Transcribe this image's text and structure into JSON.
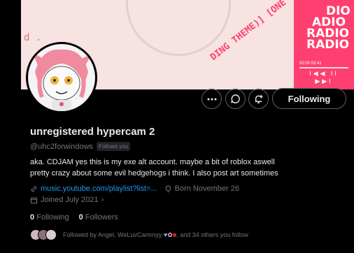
{
  "banner": {
    "left_text": "d .",
    "radio_lines": [
      "DIO",
      "ADIO",
      "RADIO",
      "RADIO"
    ],
    "diagonal_text": "DING THEME)] [ONE",
    "player_time": "02:00   03:41",
    "player_controls": "I◀◀ II ▶▶I"
  },
  "profile": {
    "display_name": "unregistered hypercam 2",
    "handle": "@uhc2forwindows",
    "follows_you_badge": "Follows you",
    "bio_line1": "aka. CDJAM yes this is my exe alt account. maybe a bit of roblox aswell",
    "bio_line2": "pretty crazy about some evil hedgehogs i think. I also post art sometimes",
    "link": "music.youtube.com/playlist?list=...",
    "birthday": "Born November 26",
    "joined": "Joined July 2021"
  },
  "actions": {
    "follow_label": "Following"
  },
  "stats": {
    "following_count": "0",
    "following_label": "Following",
    "followers_count": "0",
    "followers_label": "Followers"
  },
  "followed_by": {
    "prefix": "Followed by Angel, ",
    "name2": "WeLuvCammyy",
    "suffix": ", and 34 others you follow"
  },
  "icons": {
    "more": "more-icon",
    "message": "message-icon",
    "notify": "notification-add-icon",
    "link": "link-icon",
    "birthday": "balloon-icon",
    "calendar": "calendar-icon"
  }
}
